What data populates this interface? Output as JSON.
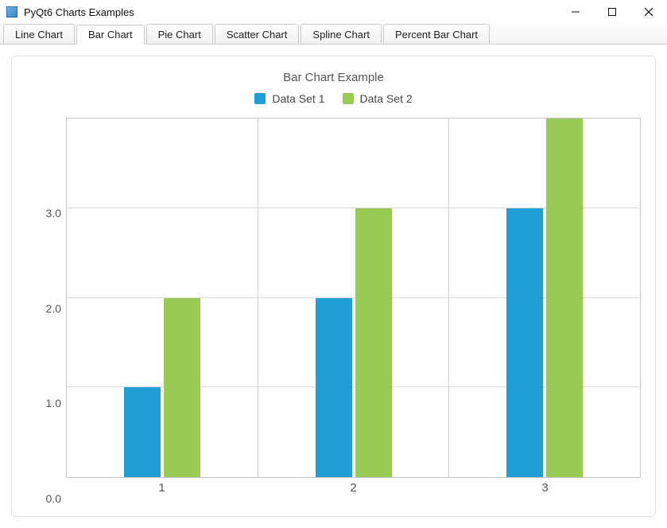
{
  "window": {
    "title": "PyQt6 Charts Examples"
  },
  "tabs": [
    {
      "label": "Line Chart",
      "active": false
    },
    {
      "label": "Bar Chart",
      "active": true
    },
    {
      "label": "Pie Chart",
      "active": false
    },
    {
      "label": "Scatter Chart",
      "active": false
    },
    {
      "label": "Spline Chart",
      "active": false
    },
    {
      "label": "Percent Bar Chart",
      "active": false
    }
  ],
  "chart": {
    "title": "Bar Chart Example"
  },
  "colors": {
    "series0": "#209fd6",
    "series1": "#99ca53"
  },
  "chart_data": {
    "type": "bar",
    "title": "Bar Chart Example",
    "categories": [
      "1",
      "2",
      "3"
    ],
    "series": [
      {
        "name": "Data Set 1",
        "values": [
          1,
          2,
          3
        ],
        "color": "#209fd6"
      },
      {
        "name": "Data Set 2",
        "values": [
          2,
          3,
          4
        ],
        "color": "#99ca53"
      }
    ],
    "xlabel": "",
    "ylabel": "",
    "ylim": [
      0.0,
      4.0
    ],
    "yticks": [
      0.0,
      1.0,
      2.0,
      3.0
    ],
    "ytick_labels": [
      "0.0",
      "1.0",
      "2.0",
      "3.0"
    ],
    "grid": true,
    "legend_position": "top"
  }
}
